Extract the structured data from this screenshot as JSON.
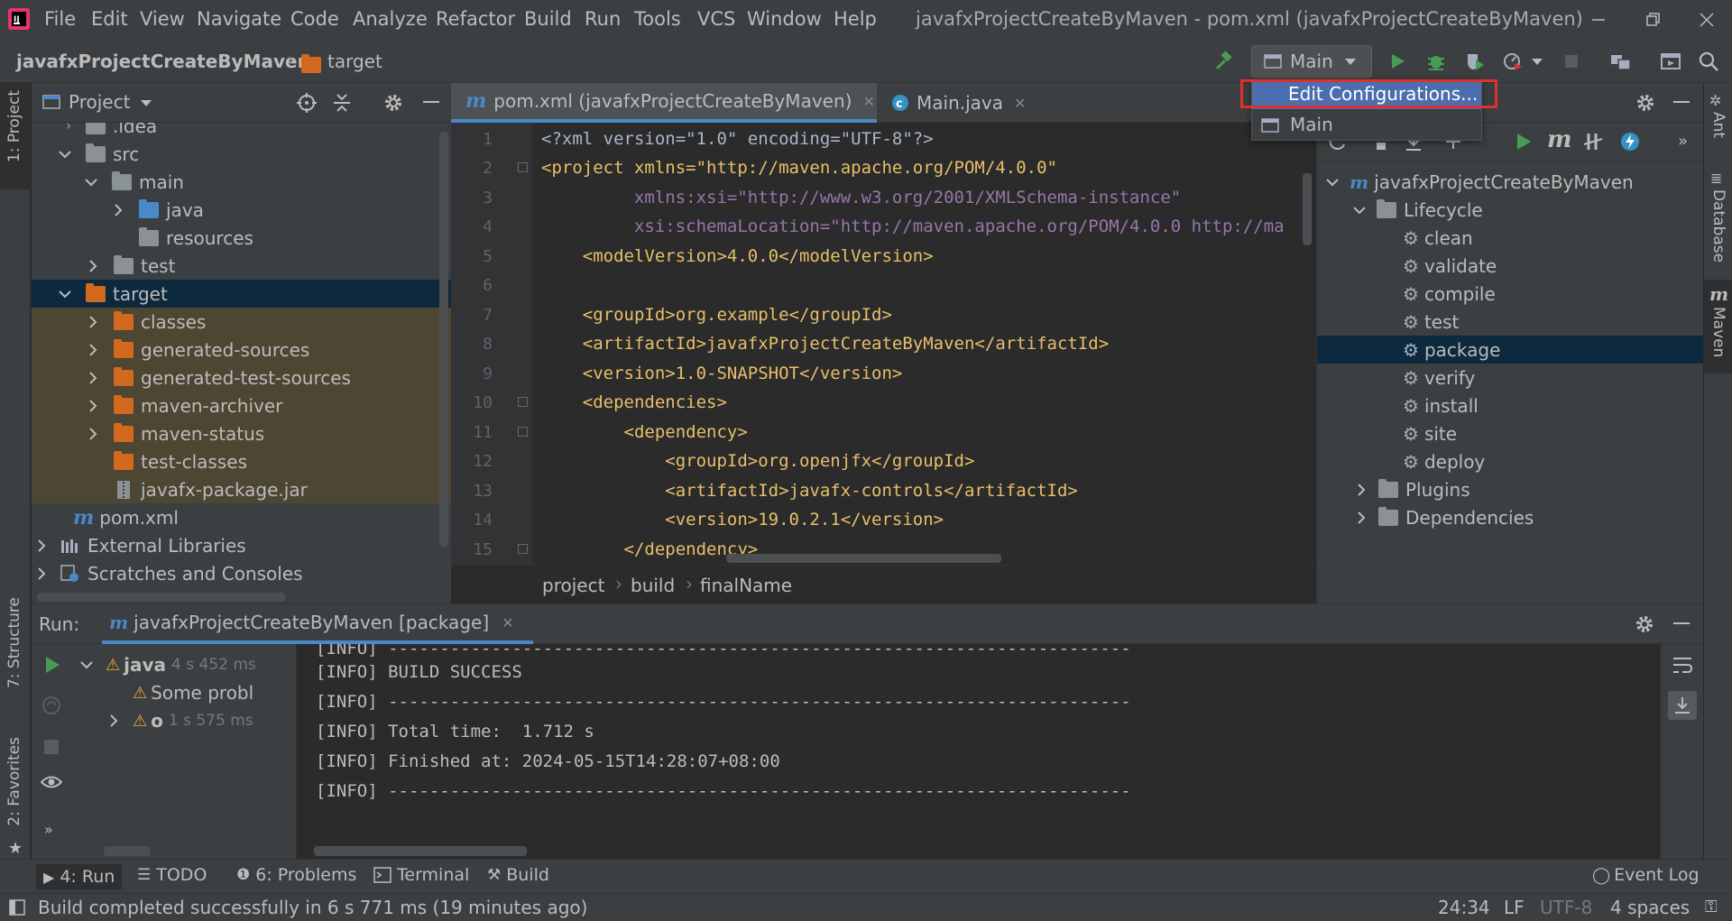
{
  "menubar": {
    "items": [
      "File",
      "Edit",
      "View",
      "Navigate",
      "Code",
      "Analyze",
      "Refactor",
      "Build",
      "Run",
      "Tools",
      "VCS",
      "Window",
      "Help"
    ],
    "window_title": "javafxProjectCreateByMaven - pom.xml (javafxProjectCreateByMaven)"
  },
  "navbar": {
    "project": "javafxProjectCreateByMaven",
    "folder": "target",
    "run_config": "Main"
  },
  "run_config_popup": {
    "items": [
      "Edit Configurations...",
      "Main"
    ]
  },
  "left_stripe": {
    "project": "1: Project",
    "structure": "7: Structure",
    "favorites": "2: Favorites"
  },
  "right_stripe": {
    "ant": "Ant",
    "database": "Database",
    "maven": "Maven"
  },
  "project_panel": {
    "title": "Project",
    "items": [
      {
        "label": ".idea",
        "indent": 1
      },
      {
        "label": "src",
        "indent": 1
      },
      {
        "label": "main",
        "indent": 2
      },
      {
        "label": "java",
        "indent": 3
      },
      {
        "label": "resources",
        "indent": 3
      },
      {
        "label": "test",
        "indent": 2
      },
      {
        "label": "target",
        "indent": 1
      },
      {
        "label": "classes",
        "indent": 2
      },
      {
        "label": "generated-sources",
        "indent": 2
      },
      {
        "label": "generated-test-sources",
        "indent": 2
      },
      {
        "label": "maven-archiver",
        "indent": 2
      },
      {
        "label": "maven-status",
        "indent": 2
      },
      {
        "label": "test-classes",
        "indent": 2
      },
      {
        "label": "javafx-package.jar",
        "indent": 2
      },
      {
        "label": "pom.xml",
        "indent": 1
      },
      {
        "label": "External Libraries",
        "indent": 0
      },
      {
        "label": "Scratches and Consoles",
        "indent": 0
      }
    ]
  },
  "editor": {
    "tabs": [
      "pom.xml (javafxProjectCreateByMaven)",
      "Main.java"
    ],
    "line_numbers": [
      "1",
      "2",
      "3",
      "4",
      "5",
      "6",
      "7",
      "8",
      "9",
      "10",
      "11",
      "12",
      "13",
      "14",
      "15"
    ],
    "lines": {
      "l1": "<?xml version=\"1.0\" encoding=\"UTF-8\"?>",
      "l2": "<project xmlns=\"http://maven.apache.org/POM/4.0.0\"",
      "l3": "         xmlns:xsi=\"http://www.w3.org/2001/XMLSchema-instance\"",
      "l4": "         xsi:schemaLocation=\"http://maven.apache.org/POM/4.0.0 http://ma",
      "l5": "    <modelVersion>4.0.0</modelVersion>",
      "l6": "",
      "l7": "    <groupId>org.example</groupId>",
      "l8": "    <artifactId>javafxProjectCreateByMaven</artifactId>",
      "l9": "    <version>1.0-SNAPSHOT</version>",
      "l10": "    <dependencies>",
      "l11": "        <dependency>",
      "l12": "            <groupId>org.openjfx</groupId>",
      "l13": "            <artifactId>javafx-controls</artifactId>",
      "l14": "            <version>19.0.2.1</version>",
      "l15": "        </dependency>"
    },
    "breadcrumb": [
      "project",
      "build",
      "finalName"
    ]
  },
  "maven_panel": {
    "root": "javafxProjectCreateByMaven",
    "lifecycle": "Lifecycle",
    "goals": [
      "clean",
      "validate",
      "compile",
      "test",
      "package",
      "verify",
      "install",
      "site",
      "deploy"
    ],
    "plugins": "Plugins",
    "dependencies": "Dependencies"
  },
  "run_panel": {
    "label": "Run:",
    "tab": "javafxProjectCreateByMaven [package]",
    "tree": [
      {
        "label": "java",
        "time": "4 s 452 ms"
      },
      {
        "label": "Some probl",
        "time": ""
      },
      {
        "label": "o",
        "time": "1 s 575 ms"
      }
    ],
    "console": [
      "[INFO] ------------------------------------------------------------------------",
      "[INFO] BUILD SUCCESS",
      "[INFO] ------------------------------------------------------------------------",
      "[INFO] Total time:  1.712 s",
      "[INFO] Finished at: 2024-05-15T14:28:07+08:00",
      "[INFO] ------------------------------------------------------------------------"
    ]
  },
  "bottom_tabs": {
    "run": "4: Run",
    "todo": "TODO",
    "problems": "6: Problems",
    "terminal": "Terminal",
    "build": "Build",
    "event_log": "Event Log"
  },
  "status": {
    "message": "Build completed successfully in 6 s 771 ms (19 minutes ago)",
    "position": "24:34",
    "line_sep": "LF",
    "encoding": "UTF-8",
    "indent": "4 spaces"
  },
  "colors": {
    "accent": "#4a88c7",
    "selection": "#0d293e",
    "popup_highlight": "#4b6eaf",
    "annotation_red": "#e0302e",
    "run_green": "#499c54",
    "folder_orange": "#d2691e",
    "folder_gray": "#8b9296"
  }
}
